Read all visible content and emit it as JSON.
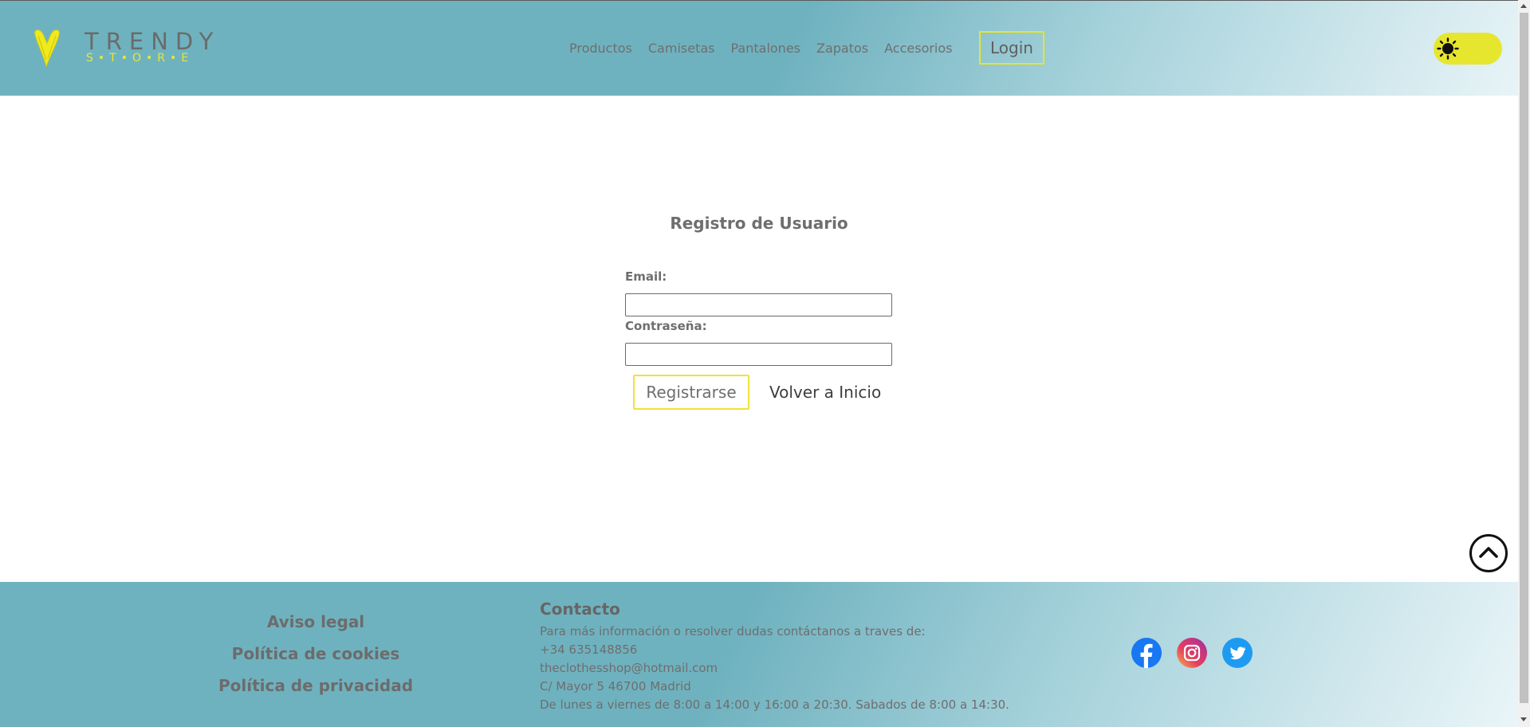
{
  "header": {
    "logo": {
      "brand": "TRENDY",
      "sub": "S•T•O•R•E"
    },
    "nav": [
      "Productos",
      "Camisetas",
      "Pantalones",
      "Zapatos",
      "Accesorios"
    ],
    "login_label": "Login",
    "theme_toggle_icon": "sun-icon"
  },
  "main": {
    "title": "Registro de Usuario",
    "email_label": "Email:",
    "email_value": "",
    "password_label": "Contraseña:",
    "password_value": "",
    "register_label": "Registrarse",
    "back_label": "Volver a Inicio",
    "scroll_top_icon": "chevron-up-icon"
  },
  "footer": {
    "legal": [
      "Aviso legal",
      "Política de cookies",
      "Política de privacidad"
    ],
    "contact": {
      "title": "Contacto",
      "intro": "Para más información o resolver dudas contáctanos a traves de:",
      "phone": "+34 635148856",
      "email": "theclothesshop@hotmail.com",
      "address": "C/ Mayor 5 46700 Madrid",
      "hours": "De lunes a viernes de 8:00 a 14:00 y 16:00 a 20:30. Sabados de 8:00 a 14:30."
    },
    "social": [
      "facebook-icon",
      "instagram-icon",
      "twitter-icon"
    ]
  },
  "colors": {
    "header_teal": "#6fb2bf",
    "accent_yellow": "#e6e62e",
    "text_gray": "#6e6e6e"
  }
}
